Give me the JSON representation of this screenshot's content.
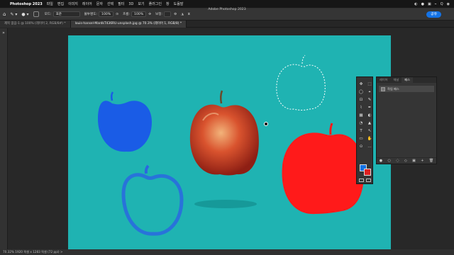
{
  "menubar": {
    "apple_glyph": "",
    "app_name": "Photoshop 2023",
    "menus": [
      "파일",
      "편집",
      "이미지",
      "레이어",
      "문자",
      "선택",
      "필터",
      "3D",
      "보기",
      "플러그인",
      "창",
      "도움말"
    ],
    "clock": "",
    "status_glyphs": [
      "◐",
      "●",
      "▣",
      "⌁",
      "Q",
      "◉"
    ]
  },
  "window": {
    "title": "Adobe Photoshop 2023"
  },
  "options_bar": {
    "mode_label": "모드:",
    "mode_value": "표준",
    "opacity_label": "불투명도:",
    "opacity_value": "100%",
    "flow_label": "흐름:",
    "flow_value": "100%",
    "smoothing_label": "보정:",
    "share_label": "공유"
  },
  "tabs": [
    {
      "label": "제목 없음-1 @ 100% (레이어 2, RGB/8#) *",
      "active": false
    },
    {
      "label": "louis-hansel-MardkT436RU-unsplash.jpg @ 70.3% (레이어 1, RGB/8) *",
      "active": true
    }
  ],
  "status_bar": {
    "text": "70.32%   1920 픽셀 x 1283 픽셀 (72 ppi)   >"
  },
  "layers_panel": {
    "tabs": [
      {
        "label": "레이어",
        "active": false
      },
      {
        "label": "채널",
        "active": false
      },
      {
        "label": "패스",
        "active": true
      }
    ],
    "rows": [
      {
        "label": "작업 패스"
      }
    ],
    "footer_icons": [
      "●",
      "○",
      "◌",
      "◇",
      "▣",
      "+",
      "🗑"
    ]
  },
  "floating_tools": [
    "✥",
    "⬚",
    "◯",
    "⌖",
    "⊡",
    "✎",
    "⌇",
    "✒",
    "▦",
    "◐",
    "◔",
    "▲",
    "T",
    "↖",
    "▭",
    "✋",
    "⊙",
    "…"
  ],
  "colors": {
    "canvas": "#1fb3b2",
    "red_apple": "#ff1a1a",
    "blue_apple": "#1a5ce6",
    "foreground": "#1473e6",
    "background": "#e02020"
  }
}
